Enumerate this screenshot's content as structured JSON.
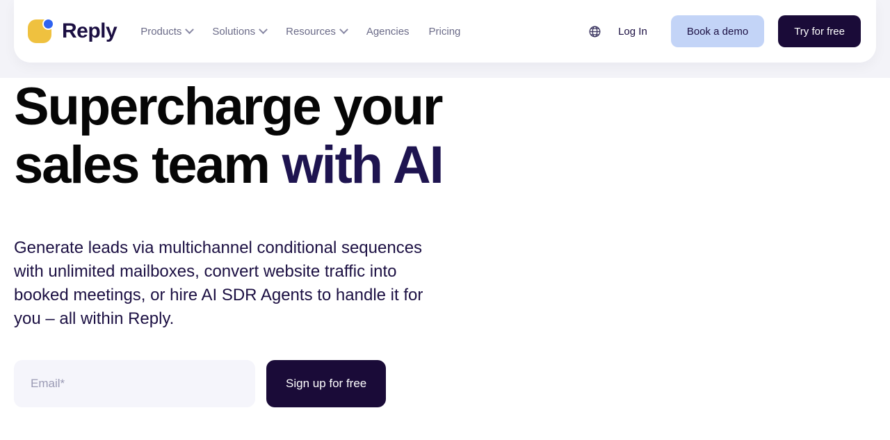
{
  "brand": {
    "name": "Reply",
    "logo_square_color": "#efc13f",
    "logo_dot_color": "#2f63f0"
  },
  "nav": {
    "items": [
      {
        "label": "Products",
        "has_dropdown": true
      },
      {
        "label": "Solutions",
        "has_dropdown": true
      },
      {
        "label": "Resources",
        "has_dropdown": true
      },
      {
        "label": "Agencies",
        "has_dropdown": false
      },
      {
        "label": "Pricing",
        "has_dropdown": false
      }
    ]
  },
  "header_actions": {
    "language_icon": "globe-icon",
    "login_label": "Log In",
    "demo_label": "Book a demo",
    "demo_color": "#c3d4f7",
    "try_label": "Try for free",
    "try_color": "#1a0b38"
  },
  "hero": {
    "title_line1": "Supercharge your",
    "title_line2_plain": "sales team ",
    "title_line2_accent": "with AI",
    "accent_color": "#1e1450",
    "subtitle": "Generate leads via multichannel conditional sequences with unlimited mailboxes, convert website traffic into booked meetings, or hire AI SDR Agents to handle it for you – all within Reply."
  },
  "signup": {
    "email_placeholder": "Email*",
    "email_value": "",
    "submit_label": "Sign up for free",
    "submit_color": "#1a0b38"
  }
}
